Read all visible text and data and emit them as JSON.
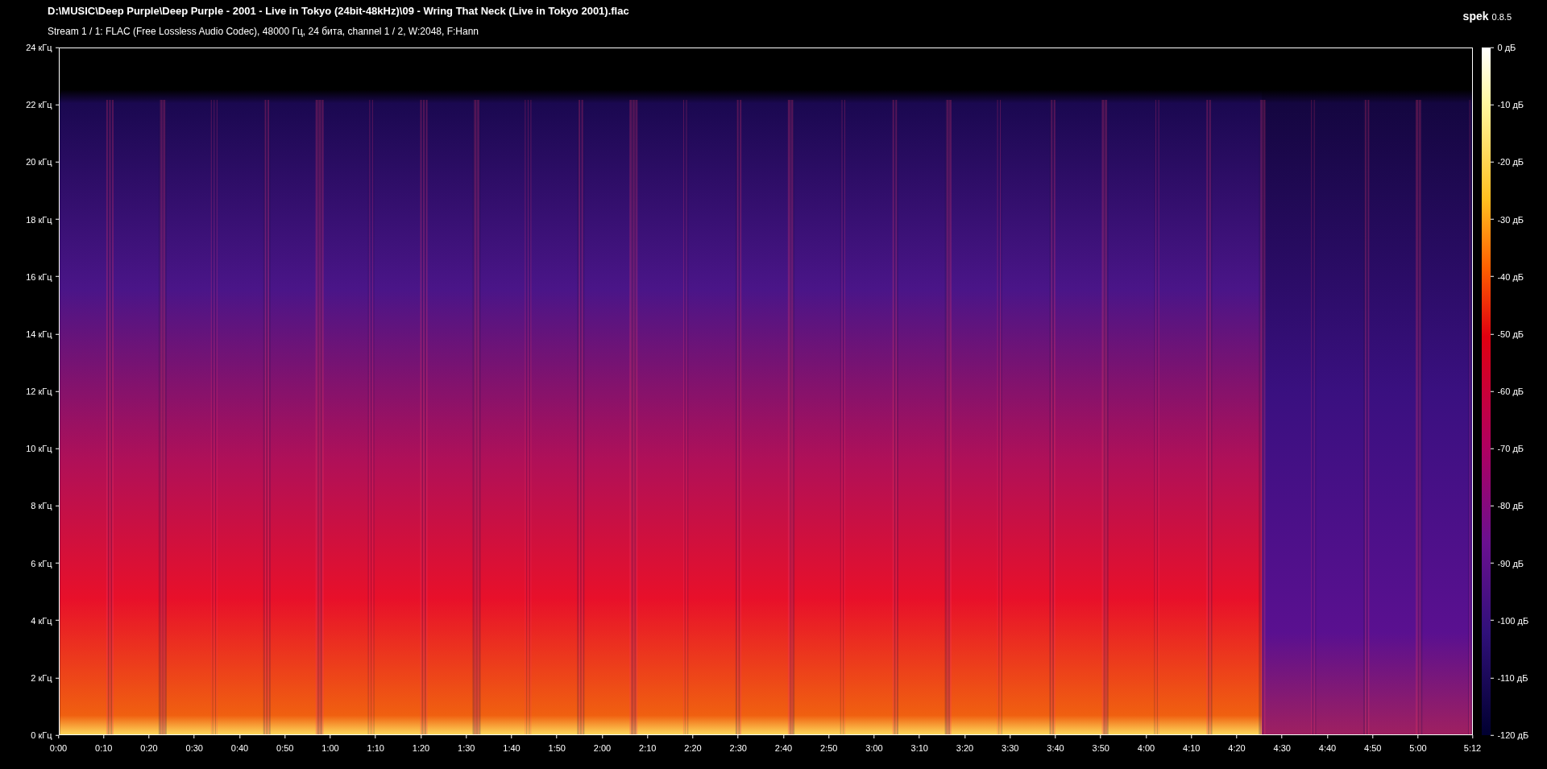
{
  "header": {
    "file_path": "D:\\MUSIC\\Deep Purple\\Deep Purple - 2001 - Live in Tokyo (24bit-48kHz)\\09 - Wring That Neck (Live in Tokyo 2001).flac",
    "stream_info": "Stream 1 / 1: FLAC (Free Lossless Audio Codec), 48000 Гц, 24 бита, channel 1 / 2, W:2048, F:Hann"
  },
  "brand": {
    "name": "spek",
    "version": "0.8.5"
  },
  "frequency_axis": [
    "24 кГц",
    "22 кГц",
    "20 кГц",
    "18 кГц",
    "16 кГц",
    "14 кГц",
    "12 кГц",
    "10 кГц",
    "8 кГц",
    "6 кГц",
    "4 кГц",
    "2 кГц",
    "0 кГц"
  ],
  "time_axis": [
    "0:00",
    "0:10",
    "0:20",
    "0:30",
    "0:40",
    "0:50",
    "1:00",
    "1:10",
    "1:20",
    "1:30",
    "1:40",
    "1:50",
    "2:00",
    "2:10",
    "2:20",
    "2:30",
    "2:40",
    "2:50",
    "3:00",
    "3:10",
    "3:20",
    "3:30",
    "3:40",
    "3:50",
    "4:00",
    "4:10",
    "4:20",
    "4:30",
    "4:40",
    "4:50",
    "5:00",
    "5:12"
  ],
  "level_scale": [
    "0 дБ",
    "-10 дБ",
    "-20 дБ",
    "-30 дБ",
    "-40 дБ",
    "-50 дБ",
    "-60 дБ",
    "-70 дБ",
    "-80 дБ",
    "-90 дБ",
    "-100 дБ",
    "-110 дБ",
    "-120 дБ"
  ]
}
